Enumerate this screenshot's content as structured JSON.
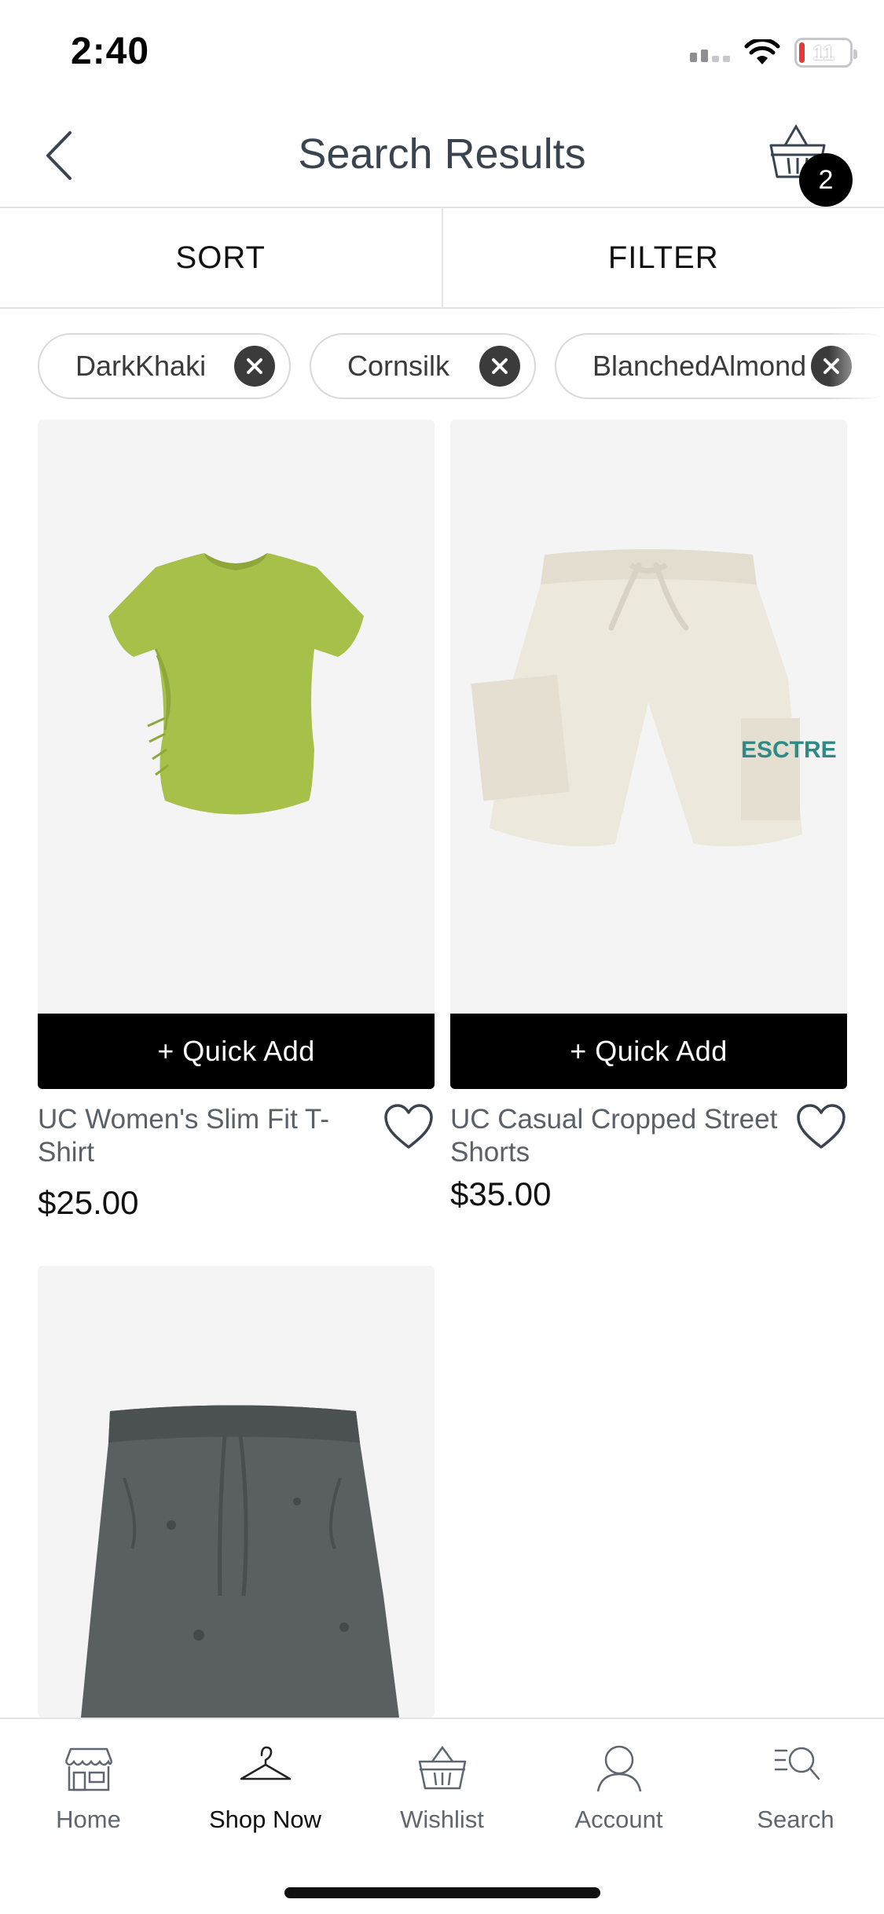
{
  "status": {
    "time": "2:40",
    "battery": "11",
    "battery_fraction": 0.11,
    "battery_color": "#e53935"
  },
  "header": {
    "title": "Search Results",
    "cart_count": "2"
  },
  "sortbar": {
    "sort_label": "SORT",
    "filter_label": "FILTER"
  },
  "chips": [
    "DarkKhaki",
    "Cornsilk",
    "BlanchedAlmond"
  ],
  "products": [
    {
      "name": "UC Women's Slim Fit T-Shirt",
      "price": "$25.00",
      "quick_add": "+ Quick Add",
      "image": "green-tshirt"
    },
    {
      "name": "UC Casual Cropped Street Shorts",
      "price": "$35.00",
      "quick_add": "+ Quick Add",
      "image": "cream-shorts",
      "print": "ESCTRE"
    },
    {
      "image": "grey-shorts"
    }
  ],
  "tabbar": {
    "active": "Shop Now",
    "items": [
      {
        "label": "Home",
        "icon": "storefront-icon"
      },
      {
        "label": "Shop Now",
        "icon": "hanger-icon"
      },
      {
        "label": "Wishlist",
        "icon": "basket-icon"
      },
      {
        "label": "Account",
        "icon": "person-icon"
      },
      {
        "label": "Search",
        "icon": "search-list-icon"
      }
    ]
  },
  "colors": {
    "accent": "#000000",
    "product_bg": "#f4f4f4",
    "title": "#3a4450"
  }
}
